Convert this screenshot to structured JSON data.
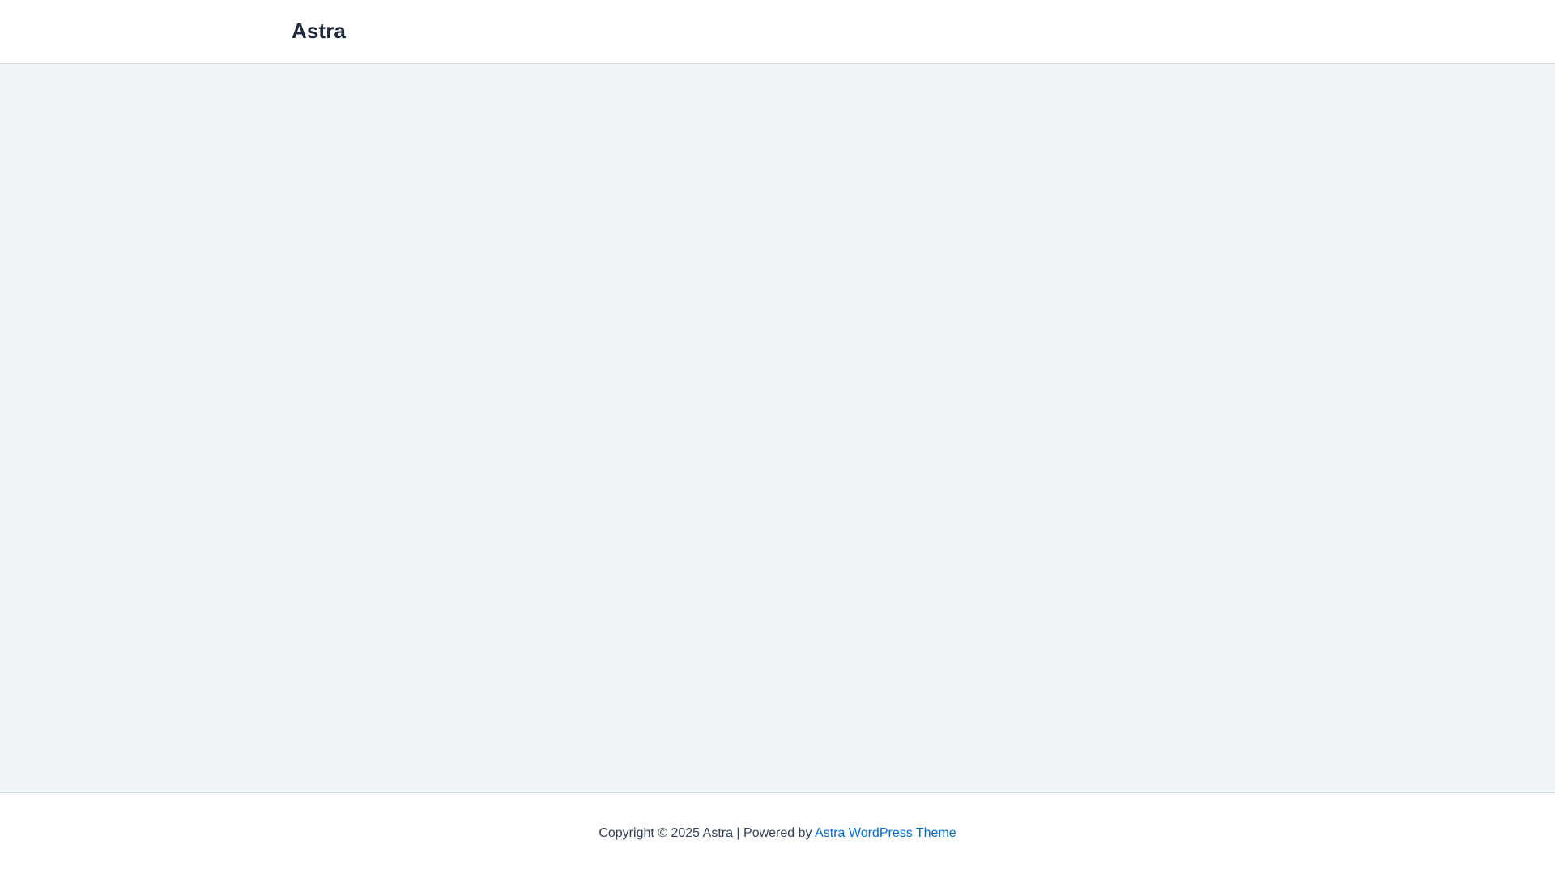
{
  "header": {
    "site_title": "Astra"
  },
  "footer": {
    "copyright": "Copyright © 2025 Astra | Powered by ",
    "theme_link": "Astra WordPress Theme"
  },
  "colors": {
    "title": "#1e293b",
    "content_bg": "#eff4f7",
    "border": "#d6dde3",
    "link": "#046bd2",
    "footer_text": "#334155"
  }
}
